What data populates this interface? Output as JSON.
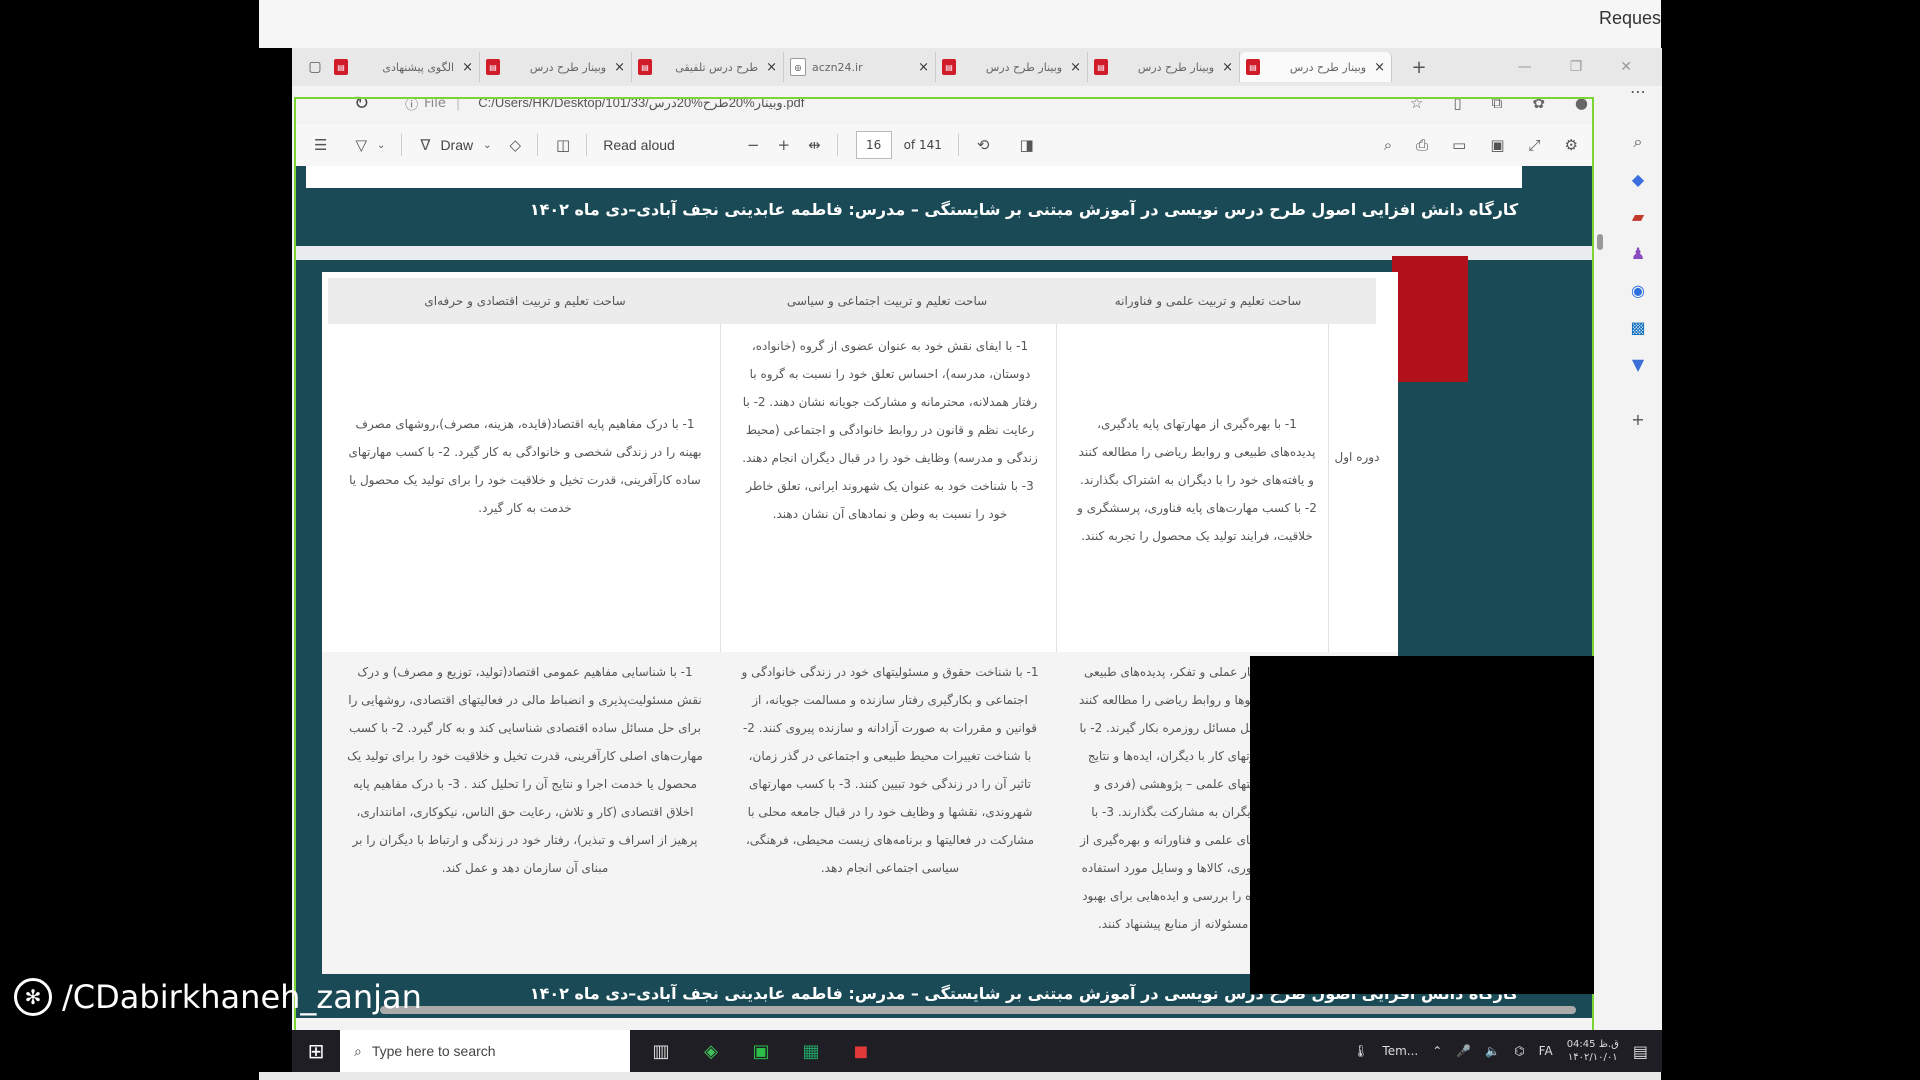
{
  "top_strip": {
    "request_text": "Reques"
  },
  "browser": {
    "tabs": [
      {
        "title": "الگوی پیشنهادی",
        "active": false
      },
      {
        "title": "وبینار طرح درس",
        "active": false
      },
      {
        "title": "طرح درس تلفیقی",
        "active": false
      },
      {
        "title": "aczn24.ir",
        "active": false
      },
      {
        "title": "وبینار طرح درس",
        "active": false
      },
      {
        "title": "وبینار طرح درس",
        "active": false
      },
      {
        "title": "وبینار طرح درس",
        "active": true
      }
    ],
    "new_tab": "+",
    "address": {
      "file_label": "File",
      "url": "C:/Users/HK/Desktop/101/وبینار%20طرح%20درس/33.pdf"
    }
  },
  "pdf_toolbar": {
    "draw_label": "Draw",
    "read_aloud_label": "Read aloud",
    "current_page": "16",
    "page_count": "of 141"
  },
  "pdf": {
    "header_title": "کارگاه دانش افزایی اصول طرح درس نویسی در آموزش مبتنی بر شایستگی  – مدرس: فاطمه عابدینی نجف آبادی–دی ماه ۱۴۰۲",
    "footer_title": "کارگاه دانش افزایی اصول طرح درس نویسی در آموزش مبتنی بر شایستگی  – مدرس: فاطمه عابدینی نجف آبادی–دی ماه ۱۴۰۲",
    "table": {
      "headers": [
        "ساحت تعلیم و تربیت علمی و فناورانه",
        "ساحت تعلیم و تربیت  اجتماعی و سیاسی",
        "ساحت تعلیم و تربیت  اقتصادی و حرفه‌ای"
      ],
      "row1_label": "دوره اول",
      "row1": [
        "1- با بهره‌گیری از مهارتهای پایه یادگیری، پدیده‌های طبیعی و روابط ریاضی را مطالعه کنند و یافته‌های خود را با دیگران به اشتراک بگذارند.  2- با کسب مهارت‌های پایه فناوری، پرسشگری و خلاقیت، فرایند تولید یک محصول را تجربه کنند.",
        "1- با ایفای نقش خود به عنوان عضوی از گروه (خانواده، دوستان، مدرسه)، احساس تعلق خود را نسبت به گروه با رفتار همدلانه، محترمانه و مشارکت جویانه نشان دهند.  2- با رعایت نظم و قانون در روابط خانوادگی و اجتماعی (محیط زندگی و مدرسه) وظایف خود را در قبال دیگران انجام دهند. 3- با شناخت خود به عنوان یک شهروند ایرانی، تعلق خاطر خود را نسبت به وطن و نمادهای آن نشان دهند.",
        "1- با درک مفاهیم پایه اقتصاد(فایده، هزینه، مصرف)،روشهای مصرف بهینه را در زندگی شخصی و خانوادگی به کار گیرد.  2- با کسب  مهارتهای ساده کارآفرینی، قدرت تخیل و خلاقیت خود را برای تولید یک محصول یا خدمت  به کار گیرد."
      ],
      "row2": [
        "1- با مهارتهای کار عملی و تفکر، پدیده‌های طبیعی (آیات الهی) و الگوها و روابط ریاضی را مطالعه کنند و از آن را برای حل مسائل روزمره بکار گیرند. 2- با استفاده از مهارتهای کار با دیگران، ایده‌ها و نتایج حاصل از فعالیتهای علمی – پژوهشی (فردی و گروهی) را با دیگران به مشارکت بگذارند.  3- با استفاده از یافته‌های علمی و فناورانه و بهره‌گیری از مهارتهای پایه فناوری، کالاها و وسایل مورد استفاده در زندگی روزمره را بررسی و ایده‌هایی برای بهبود آن و استفاده مسئولانه از منابع پیشنهاد کنند.",
        "1- با شناخت حقوق و مسئولیتهای خود در زندگی خانوادگی و اجتماعی و بکارگیری رفتار سازنده و مسالمت جویانه، از قوانین و مقررات به صورت آزادانه و سازنده پیروی کنند.  2- با شناخت تغییرات محیط طبیعی و اجتماعی در گذر زمان، تاثیر آن را در زندگی خود تبیین کنند.  3- با کسب مهارتهای شهروندی، نقشها و وظایف خود را در قبال جامعه محلی با مشارکت در فعالیتها و برنامه‌های زیست محیطی، فرهنگی، سیاسی اجتماعی انجام دهد.",
        "1- با شناسایی  مفاهیم عمومی اقتصاد(تولید، توزیع و مصرف) و درک نقش مسئولیت‌پذیری و انضباط مالی در فعالیتهای اقتصادی، روشهایی را برای حل مسائل ساده اقتصادی شناسایی کند و به کار گیرد.  2- با کسب مهارت‌های اصلی کارآفرینی، قدرت تخیل و خلاقیت خود را برای تولید یک محصول یا خدمت اجرا و نتایج آن را تحلیل کند . 3- با درک مفاهیم پایه اخلاق اقتصادی (کار و تلاش، رعایت حق الناس، نیکوکاری، امانتداری، پرهیز از اسراف و تبذیر)، رفتار خود در زندگی و ارتباط با دیگران را بر مبنای آن سازمان دهد و عمل کند."
      ]
    }
  },
  "taskbar": {
    "search_placeholder": "Type here to search",
    "weather": "Tem...",
    "lang": "FA",
    "time": "04:45 ق.ظ",
    "date": "۱۴۰۲/۱۰/۰۱"
  },
  "watermark": {
    "text": "/CDabirkhaneh_zanjan"
  },
  "colors": {
    "pdf_bg": "#1a4a55",
    "highlight_border": "#7ad432",
    "accent_red": "#b0111b"
  }
}
